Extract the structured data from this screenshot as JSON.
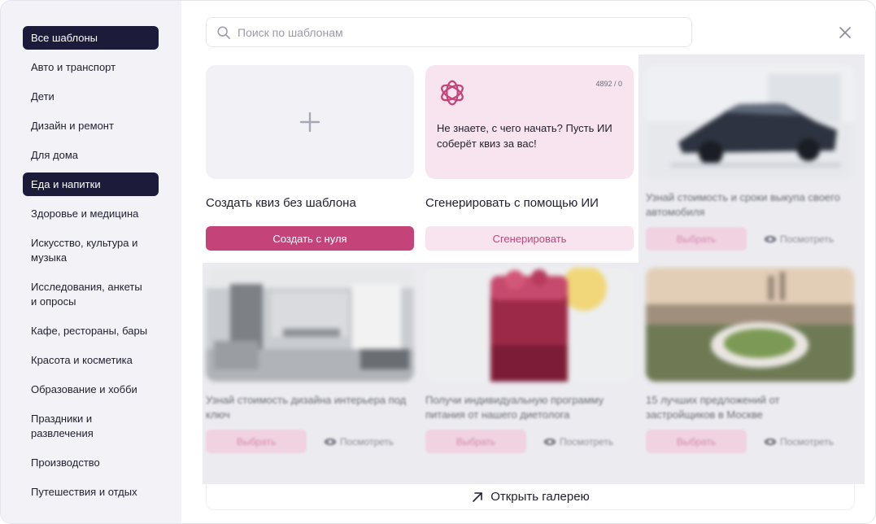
{
  "search": {
    "placeholder": "Поиск по шаблонам"
  },
  "sidebar": {
    "items": [
      {
        "label": "Все шаблоны"
      },
      {
        "label": "Авто и транспорт"
      },
      {
        "label": "Дети"
      },
      {
        "label": "Дизайн и ремонт"
      },
      {
        "label": "Для дома"
      },
      {
        "label": "Еда и напитки"
      },
      {
        "label": "Здоровье и медицина"
      },
      {
        "label": "Искусство, культура и музыка"
      },
      {
        "label": "Исследования, анкеты и опросы"
      },
      {
        "label": "Кафе, рестораны, бары"
      },
      {
        "label": "Красота и косметика"
      },
      {
        "label": "Образование и хобби"
      },
      {
        "label": "Праздники и развлечения"
      },
      {
        "label": "Производство"
      },
      {
        "label": "Путешествия и отдых"
      }
    ]
  },
  "create": {
    "title": "Создать квиз без шаблона",
    "button": "Создать с нуля"
  },
  "ai": {
    "counter": "4892 / 0",
    "text": "Не знаете, с чего начать? Пусть ИИ соберёт квиз за вас!",
    "title": "Сгенерировать с помощью ИИ",
    "button": "Сгенерировать"
  },
  "templates": [
    {
      "title": "Узнай стоимость и сроки выкупа своего автомобиля",
      "choose": "Выбрать",
      "view": "Посмотреть"
    },
    {
      "title": "Узнай стоимость дизайна интерьера под ключ",
      "choose": "Выбрать",
      "view": "Посмотреть"
    },
    {
      "title": "Получи индивидуальную программу питания от нашего диетолога",
      "choose": "Выбрать",
      "view": "Посмотреть"
    },
    {
      "title": "15 лучших предложений от застройщиков в Москве",
      "choose": "Выбрать",
      "view": "Посмотреть"
    }
  ],
  "gallery_link": "Открыть галерею",
  "colors": {
    "accent": "#c4447a",
    "accent_soft": "#f7e4ee",
    "active_item": "#1c1b3a",
    "sidebar_bg": "#f3f3f7"
  },
  "icons": {
    "search": "search-icon",
    "close": "close-icon",
    "plus": "plus-icon",
    "ai": "openai-logo-icon",
    "eye": "eye-icon",
    "arrow": "arrow-up-right-icon"
  }
}
